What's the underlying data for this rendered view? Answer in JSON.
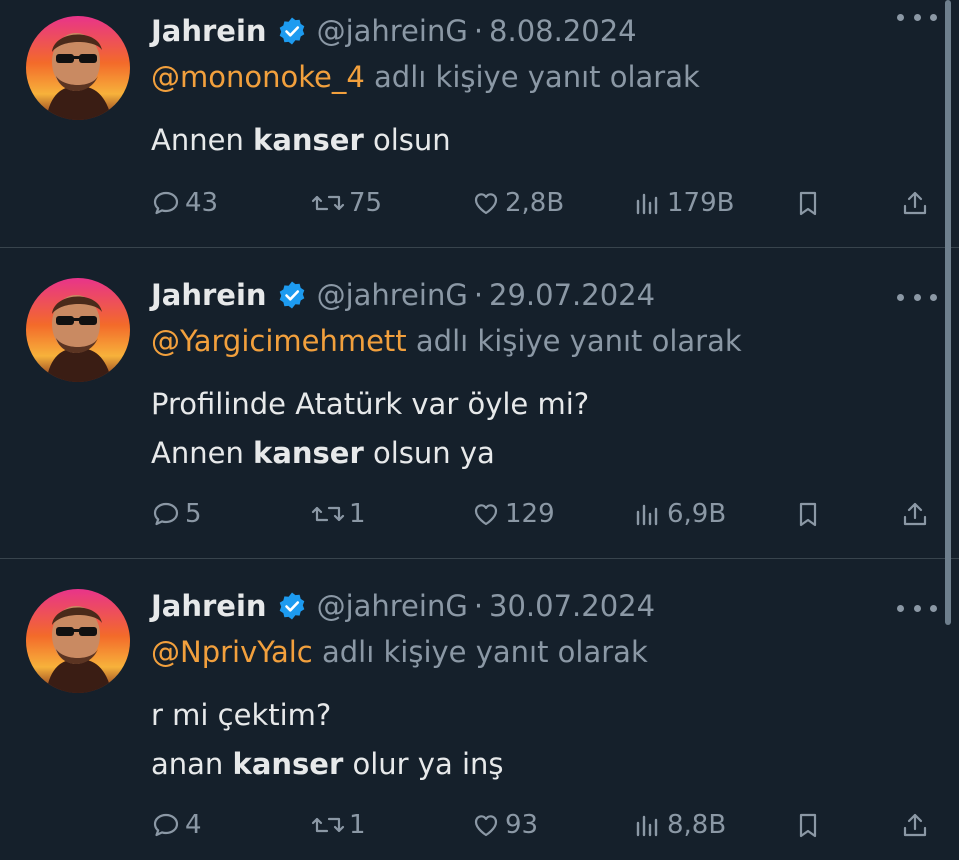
{
  "tweets": [
    {
      "author": "Jahrein",
      "handle": "@jahreinG",
      "separator": "·",
      "date": "8.08.2024",
      "reply_to": "@mononoke_4",
      "reply_suffix": "adlı kişiye yanıt olarak",
      "lines": [
        {
          "pre": "Annen ",
          "bold": "kanser",
          "post": " olsun"
        }
      ],
      "replies": "43",
      "retweets": "75",
      "likes": "2,8B",
      "views": "179B"
    },
    {
      "author": "Jahrein",
      "handle": "@jahreinG",
      "separator": "·",
      "date": "29.07.2024",
      "reply_to": "@Yargicimehmett",
      "reply_suffix": "adlı kişiye yanıt olarak",
      "lines": [
        {
          "pre": "Profilinde Atatürk var öyle mi?",
          "bold": "",
          "post": ""
        },
        {
          "pre": "Annen ",
          "bold": "kanser",
          "post": " olsun ya"
        }
      ],
      "replies": "5",
      "retweets": "1",
      "likes": "129",
      "views": "6,9B"
    },
    {
      "author": "Jahrein",
      "handle": "@jahreinG",
      "separator": "·",
      "date": "30.07.2024",
      "reply_to": "@NprivYalc",
      "reply_suffix": "adlı kişiye yanıt olarak",
      "lines": [
        {
          "pre": "r mi çektim?",
          "bold": "",
          "post": ""
        },
        {
          "pre": "anan ",
          "bold": "kanser",
          "post": " olur ya inş"
        }
      ],
      "replies": "4",
      "retweets": "1",
      "likes": "93",
      "views": "8,8B"
    }
  ],
  "icons": {
    "verified": "verified-badge-icon",
    "more": "more-options-icon",
    "reply": "reply-bubble-icon",
    "retweet": "retweet-icon",
    "like": "heart-icon",
    "views": "views-bar-chart-icon",
    "bookmark": "bookmark-icon",
    "share": "share-icon"
  },
  "colors": {
    "background": "#15202b",
    "text": "#e7e9ea",
    "secondary": "#8b98a5",
    "mention": "#f2a03d",
    "verified": "#1d9bf0",
    "divider": "#38444d"
  }
}
